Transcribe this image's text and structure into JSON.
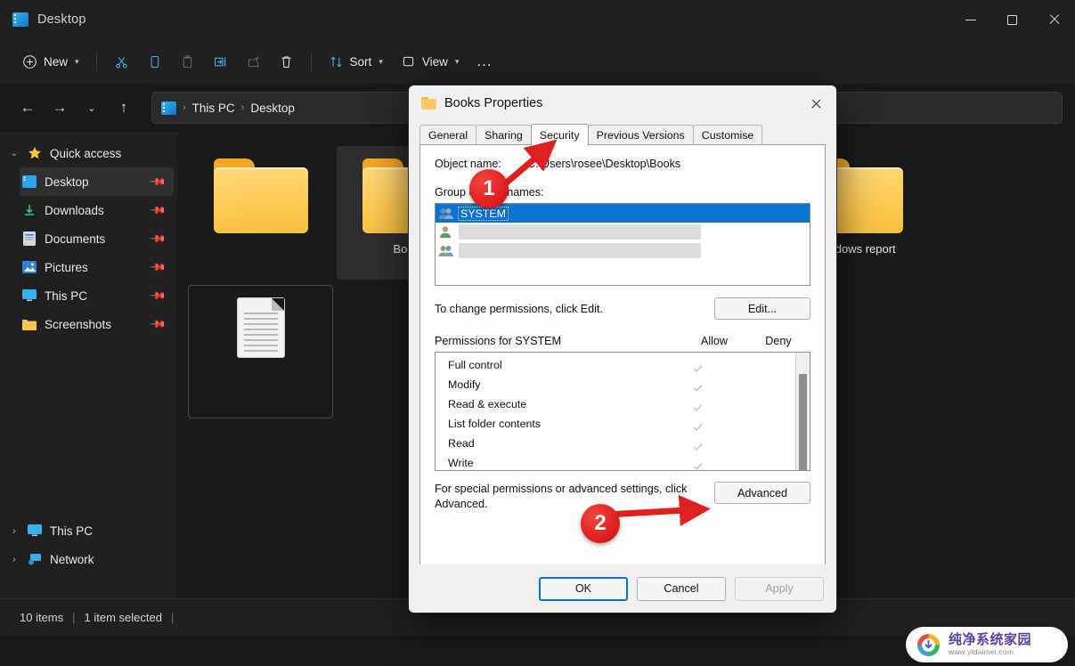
{
  "window": {
    "title": "Desktop",
    "controls": {
      "minimize": "minimize-button",
      "maximize": "maximize-button",
      "close": "close-button"
    }
  },
  "toolbar": {
    "new_label": "New",
    "cut_label": "Cut",
    "copy_label": "Copy",
    "paste_label": "Paste",
    "rename_label": "Rename",
    "share_label": "Share",
    "delete_label": "Delete",
    "sort_label": "Sort",
    "view_label": "View",
    "more_label": "..."
  },
  "addressbar": {
    "back": "Back",
    "forward": "Forward",
    "recent": "Recent locations",
    "up": "Up",
    "crumbs": [
      "This PC",
      "Desktop"
    ]
  },
  "sidebar": {
    "groups": [
      {
        "label": "Quick access",
        "icon": "star-icon",
        "expanded": true
      }
    ],
    "items": [
      {
        "label": "Desktop",
        "icon": "desktop-icon",
        "pinned": true,
        "selected": true
      },
      {
        "label": "Downloads",
        "icon": "download-icon",
        "pinned": true,
        "selected": false
      },
      {
        "label": "Documents",
        "icon": "documents-icon",
        "pinned": true,
        "selected": false
      },
      {
        "label": "Pictures",
        "icon": "pictures-icon",
        "pinned": true,
        "selected": false
      },
      {
        "label": "This PC",
        "icon": "pc-icon",
        "pinned": true,
        "selected": false
      },
      {
        "label": "Screenshots",
        "icon": "folder-icon",
        "pinned": true,
        "selected": false
      }
    ],
    "roots": [
      {
        "label": "This PC",
        "icon": "pc-icon"
      },
      {
        "label": "Network",
        "icon": "network-icon"
      }
    ]
  },
  "files": [
    {
      "label": "",
      "type": "folder",
      "selected": false
    },
    {
      "label": "Books",
      "type": "folder",
      "selected": true
    },
    {
      "label": "",
      "type": "folder",
      "selected": false
    },
    {
      "label": "",
      "type": "folder",
      "selected": false
    },
    {
      "label": "Windows report",
      "type": "folder",
      "selected": false
    },
    {
      "label": "",
      "type": "document",
      "selected": false
    }
  ],
  "statusbar": {
    "items_count": "10 items",
    "selection": "1 item selected",
    "divider": "|"
  },
  "dialog": {
    "title": "Books Properties",
    "close_label": "Close",
    "tabs": [
      {
        "label": "General",
        "active": false
      },
      {
        "label": "Sharing",
        "active": false
      },
      {
        "label": "Security",
        "active": true
      },
      {
        "label": "Previous Versions",
        "active": false
      },
      {
        "label": "Customise",
        "active": false
      }
    ],
    "object_name_label": "Object name:",
    "object_name_value": "C:\\Users\\rosee\\Desktop\\Books",
    "group_label": "Group or user names:",
    "groups": [
      {
        "name": "SYSTEM",
        "selected": true,
        "redacted": false
      },
      {
        "name": "",
        "selected": false,
        "redacted": true
      },
      {
        "name": "",
        "selected": false,
        "redacted": true
      }
    ],
    "edit_hint": "To change permissions, click Edit.",
    "edit_button": "Edit...",
    "permissions_title": "Permissions for SYSTEM",
    "col_allow": "Allow",
    "col_deny": "Deny",
    "permissions": [
      {
        "name": "Full control",
        "allow": true,
        "deny": false
      },
      {
        "name": "Modify",
        "allow": true,
        "deny": false
      },
      {
        "name": "Read & execute",
        "allow": true,
        "deny": false
      },
      {
        "name": "List folder contents",
        "allow": true,
        "deny": false
      },
      {
        "name": "Read",
        "allow": true,
        "deny": false
      },
      {
        "name": "Write",
        "allow": true,
        "deny": false
      }
    ],
    "advanced_hint": "For special permissions or advanced settings, click Advanced.",
    "advanced_button": "Advanced",
    "ok_button": "OK",
    "cancel_button": "Cancel",
    "apply_button": "Apply"
  },
  "annotations": [
    {
      "number": "1",
      "target": "security-tab"
    },
    {
      "number": "2",
      "target": "advanced-button"
    }
  ],
  "watermark": {
    "name_cn": "纯净系统家园",
    "url": "www.yidaimei.com"
  },
  "colors": {
    "accent": "#0a72d0",
    "selection": "#0a72d0",
    "annotation": "#e02020",
    "folder": "#fbcb62"
  }
}
